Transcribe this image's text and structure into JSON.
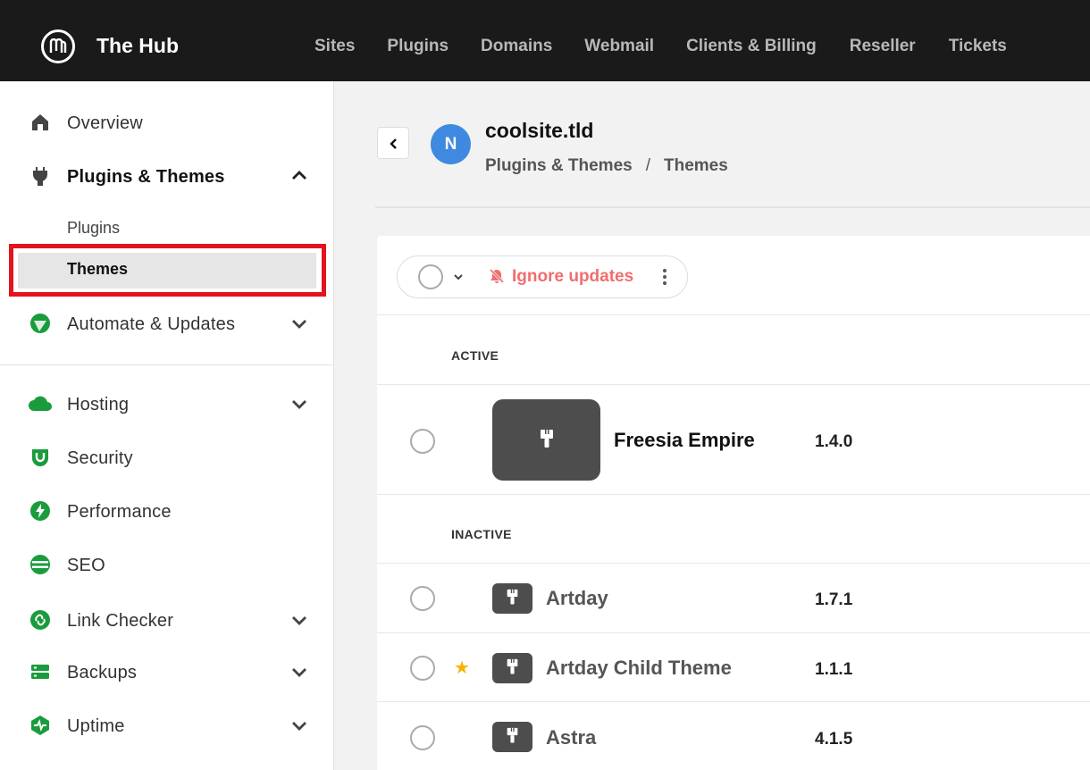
{
  "app": {
    "title": "The Hub"
  },
  "topnav": [
    "Sites",
    "Plugins",
    "Domains",
    "Webmail",
    "Clients & Billing",
    "Reseller",
    "Tickets"
  ],
  "sidebar": {
    "items": [
      {
        "label": "Overview",
        "icon": "home-icon"
      },
      {
        "label": "Plugins & Themes",
        "icon": "plug-icon",
        "expanded": true
      },
      {
        "label": "Automate & Updates",
        "icon": "automate-icon"
      },
      {
        "label": "Hosting",
        "icon": "cloud-icon"
      },
      {
        "label": "Security",
        "icon": "shield-icon"
      },
      {
        "label": "Performance",
        "icon": "bolt-icon"
      },
      {
        "label": "SEO",
        "icon": "seo-icon"
      },
      {
        "label": "Link Checker",
        "icon": "link-icon"
      },
      {
        "label": "Backups",
        "icon": "backup-icon"
      },
      {
        "label": "Uptime",
        "icon": "uptime-icon"
      }
    ],
    "subitems": [
      "Plugins",
      "Themes"
    ],
    "active_subitem": "Themes"
  },
  "header": {
    "avatar_letter": "N",
    "site_title": "coolsite.tld",
    "breadcrumb": [
      "Plugins & Themes",
      "Themes"
    ]
  },
  "toolbar": {
    "ignore_label": "Ignore updates"
  },
  "sections": {
    "active_label": "ACTIVE",
    "inactive_label": "INACTIVE"
  },
  "themes": {
    "active": [
      {
        "name": "Freesia Empire",
        "version": "1.4.0"
      }
    ],
    "inactive": [
      {
        "name": "Artday",
        "version": "1.7.1",
        "starred": false
      },
      {
        "name": "Artday Child Theme",
        "version": "1.1.1",
        "starred": true
      },
      {
        "name": "Astra",
        "version": "4.1.5",
        "starred": false
      }
    ]
  },
  "colors": {
    "topbar": "#1a1a1a",
    "accent_green": "#1a9c3c",
    "ignore_red": "#f06e6e",
    "avatar_blue": "#3f8ae0",
    "highlight_red": "#e3141f"
  }
}
